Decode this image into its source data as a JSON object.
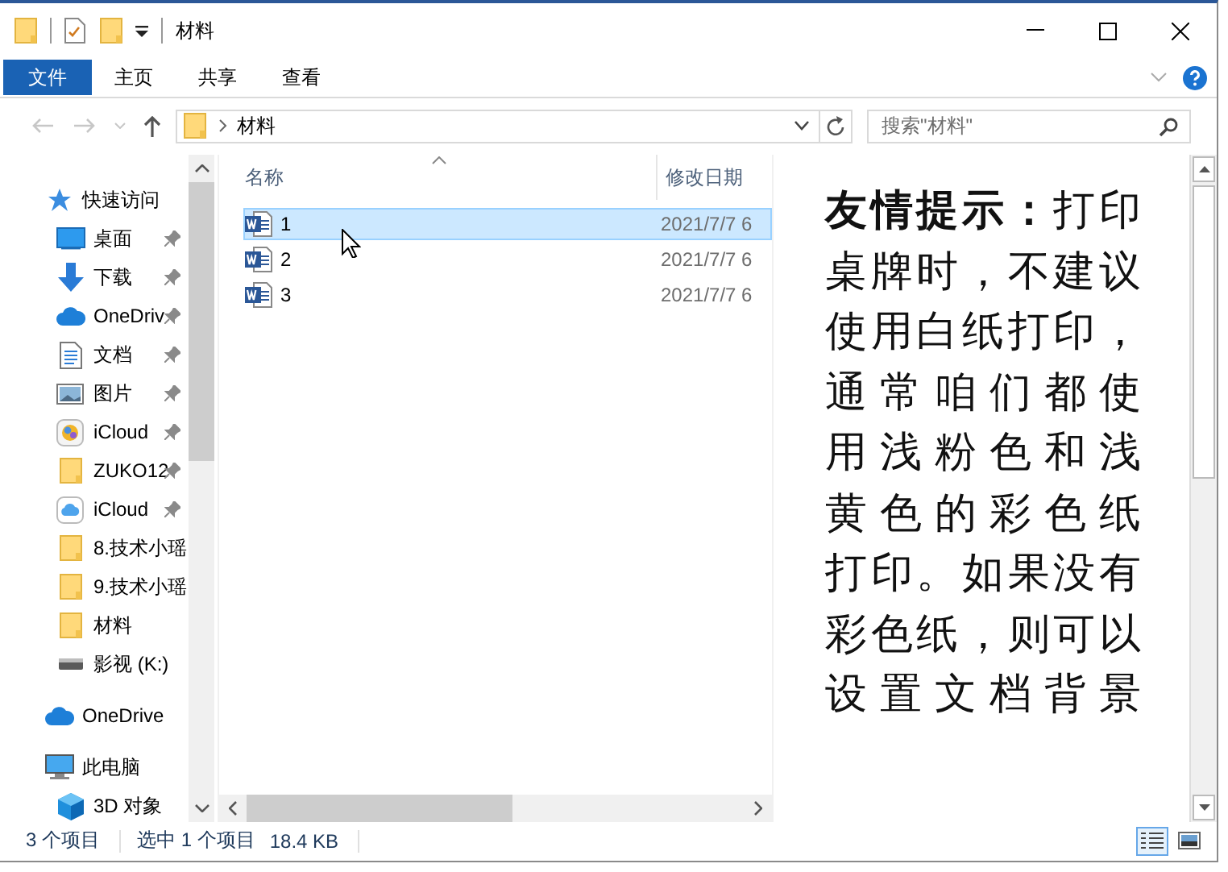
{
  "window": {
    "title": "材料"
  },
  "ribbon": {
    "tabs": [
      {
        "label": "文件",
        "kind": "file",
        "selected": false
      },
      {
        "label": "主页",
        "kind": "tab",
        "selected": false
      },
      {
        "label": "共享",
        "kind": "tab",
        "selected": false
      },
      {
        "label": "查看",
        "kind": "tab",
        "selected": false
      }
    ]
  },
  "address_bar": {
    "path": [
      "材料"
    ]
  },
  "search": {
    "placeholder": "搜索\"材料\""
  },
  "sidebar": {
    "items": [
      {
        "label": "快速访问",
        "kind": "star",
        "pinned": false,
        "children": [
          {
            "label": "桌面",
            "kind": "desktop",
            "pinned": true
          },
          {
            "label": "下载",
            "kind": "download",
            "pinned": true
          },
          {
            "label": "OneDriv",
            "kind": "cloud",
            "pinned": true
          },
          {
            "label": "文档",
            "kind": "document",
            "pinned": true
          },
          {
            "label": "图片",
            "kind": "picture",
            "pinned": true
          },
          {
            "label": "iCloud",
            "kind": "photos",
            "pinned": true
          },
          {
            "label": "ZUKO12",
            "kind": "folder",
            "pinned": true
          },
          {
            "label": "iCloud",
            "kind": "cloudbox",
            "pinned": true
          },
          {
            "label": "8.技术小瑶",
            "kind": "folder",
            "pinned": false
          },
          {
            "label": "9.技术小瑶",
            "kind": "folder",
            "pinned": false
          },
          {
            "label": "材料",
            "kind": "folder",
            "pinned": false
          },
          {
            "label": "影视 (K:)",
            "kind": "drive",
            "pinned": false
          }
        ]
      },
      {
        "label": "OneDrive",
        "kind": "cloud",
        "pinned": false
      },
      {
        "label": "此电脑",
        "kind": "pc",
        "pinned": false,
        "children": [
          {
            "label": "3D 对象",
            "kind": "cube",
            "pinned": false
          }
        ]
      }
    ]
  },
  "file_list": {
    "columns": [
      {
        "label": "名称",
        "sorted": true
      },
      {
        "label": "修改日期",
        "sorted": false
      }
    ],
    "rows": [
      {
        "name": "1",
        "modified": "2021/7/7 6",
        "selected": true
      },
      {
        "name": "2",
        "modified": "2021/7/7 6",
        "selected": false
      },
      {
        "name": "3",
        "modified": "2021/7/7 6",
        "selected": false
      }
    ]
  },
  "preview": {
    "lines": [
      "**友情提示：**打印",
      "桌牌时，不建议",
      "使用白纸打印，",
      "通常咱们都使",
      "用浅粉色和浅",
      "黄色的彩色纸",
      "打印。如果没有",
      "彩色纸，则可以",
      "设置文档背景"
    ]
  },
  "status_bar": {
    "item_count": "3 个项目",
    "selection": "选中 1 个项目",
    "size": "18.4 KB",
    "views": [
      {
        "kind": "details",
        "selected": true
      },
      {
        "kind": "large-icons",
        "selected": false
      }
    ]
  }
}
